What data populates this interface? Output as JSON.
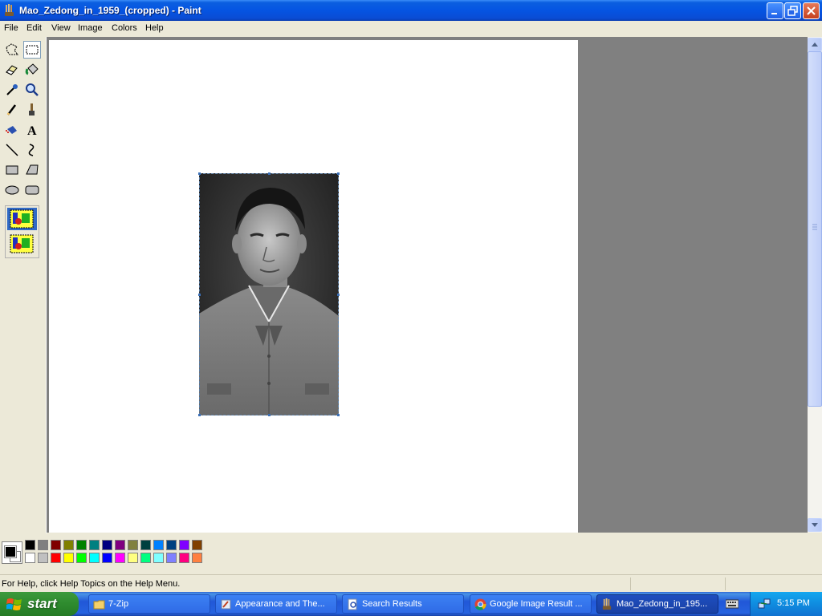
{
  "window": {
    "title": "Mao_Zedong_in_1959_(cropped) - Paint",
    "app_icon": "paint-icon"
  },
  "menu": [
    "File",
    "Edit",
    "View",
    "Image",
    "Colors",
    "Help"
  ],
  "tools": [
    {
      "name": "free-form-select-icon"
    },
    {
      "name": "rect-select-icon",
      "selected": true
    },
    {
      "name": "eraser-icon"
    },
    {
      "name": "fill-bucket-icon"
    },
    {
      "name": "pick-color-icon"
    },
    {
      "name": "magnifier-icon"
    },
    {
      "name": "pencil-icon"
    },
    {
      "name": "brush-icon"
    },
    {
      "name": "airbrush-icon"
    },
    {
      "name": "text-icon"
    },
    {
      "name": "line-icon"
    },
    {
      "name": "curve-icon"
    },
    {
      "name": "rectangle-icon"
    },
    {
      "name": "polygon-icon"
    },
    {
      "name": "ellipse-icon"
    },
    {
      "name": "rounded-rect-icon"
    }
  ],
  "palette": {
    "foreground": "#000000",
    "background": "#FFFFFF",
    "row1": [
      "#000000",
      "#808080",
      "#800000",
      "#808000",
      "#008000",
      "#008080",
      "#000080",
      "#800080",
      "#808040",
      "#004040",
      "#0080FF",
      "#004080",
      "#8000FF",
      "#804000"
    ],
    "row2": [
      "#FFFFFF",
      "#C0C0C0",
      "#FF0000",
      "#FFFF00",
      "#00FF00",
      "#00FFFF",
      "#0000FF",
      "#FF00FF",
      "#FFFF80",
      "#00FF80",
      "#80FFFF",
      "#8080FF",
      "#FF0080",
      "#FF8040"
    ]
  },
  "status": {
    "help_text": "For Help, click Help Topics on the Help Menu."
  },
  "taskbar": {
    "start_label": "start",
    "buttons": [
      {
        "label": "7-Zip",
        "icon": "folder-icon"
      },
      {
        "label": "Appearance and The...",
        "icon": "control-panel-icon"
      },
      {
        "label": "Search Results",
        "icon": "search-results-icon"
      },
      {
        "label": "Google Image Result ...",
        "icon": "chrome-icon"
      },
      {
        "label": "Mao_Zedong_in_195...",
        "icon": "paint-icon",
        "active": true
      }
    ],
    "clock": "5:15 PM"
  }
}
